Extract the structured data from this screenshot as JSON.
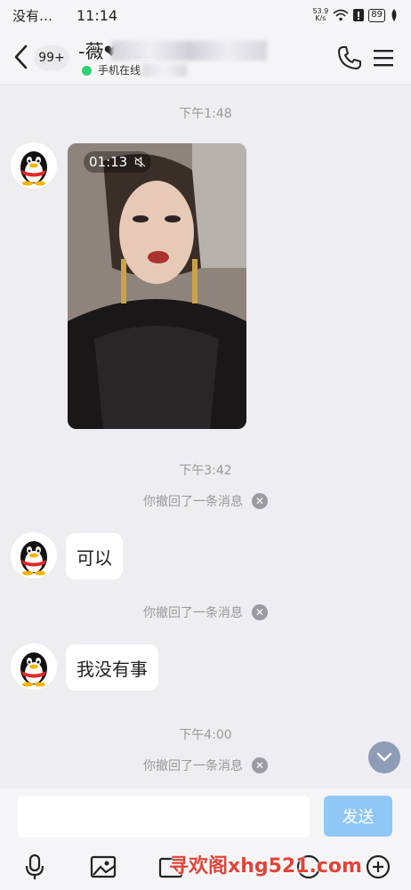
{
  "status_bar": {
    "carrier": "没有…",
    "time": "11:14",
    "net_speed_value": "53.9",
    "net_speed_unit": "K/s",
    "battery": "89"
  },
  "header": {
    "unread_count": "99+",
    "contact_name": "-薇❤h12",
    "contact_name_tail": "1",
    "online_status": "手机在线"
  },
  "messages": {
    "ts1": "下午1:48",
    "video_duration": "01:13",
    "ts2": "下午3:42",
    "recall1": "你撤回了一条消息",
    "bubble1": "可以",
    "recall2": "你撤回了一条消息",
    "bubble2": "我没有事",
    "ts3": "下午4:00",
    "recall3": "你撤回了一条消息"
  },
  "input": {
    "placeholder": "",
    "send_label": "发送"
  },
  "watermark": "寻欢阁xhg521.com",
  "colors": {
    "send_button": "#8fc7f7",
    "online_dot": "#2fd173",
    "background": "#ededf2"
  }
}
